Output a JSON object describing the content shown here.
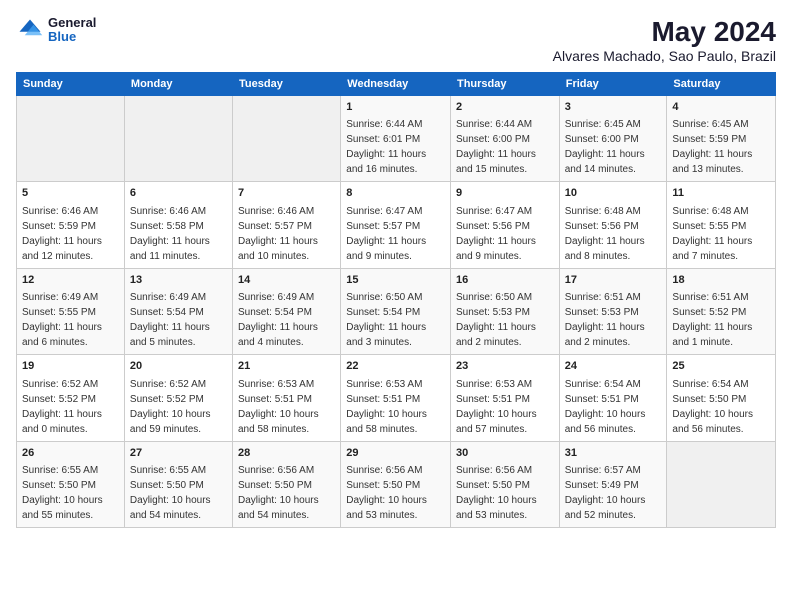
{
  "logo": {
    "line1": "General",
    "line2": "Blue"
  },
  "title": "May 2024",
  "subtitle": "Alvares Machado, Sao Paulo, Brazil",
  "days_of_week": [
    "Sunday",
    "Monday",
    "Tuesday",
    "Wednesday",
    "Thursday",
    "Friday",
    "Saturday"
  ],
  "weeks": [
    [
      {
        "day": "",
        "info": ""
      },
      {
        "day": "",
        "info": ""
      },
      {
        "day": "",
        "info": ""
      },
      {
        "day": "1",
        "info": "Sunrise: 6:44 AM\nSunset: 6:01 PM\nDaylight: 11 hours and 16 minutes."
      },
      {
        "day": "2",
        "info": "Sunrise: 6:44 AM\nSunset: 6:00 PM\nDaylight: 11 hours and 15 minutes."
      },
      {
        "day": "3",
        "info": "Sunrise: 6:45 AM\nSunset: 6:00 PM\nDaylight: 11 hours and 14 minutes."
      },
      {
        "day": "4",
        "info": "Sunrise: 6:45 AM\nSunset: 5:59 PM\nDaylight: 11 hours and 13 minutes."
      }
    ],
    [
      {
        "day": "5",
        "info": "Sunrise: 6:46 AM\nSunset: 5:59 PM\nDaylight: 11 hours and 12 minutes."
      },
      {
        "day": "6",
        "info": "Sunrise: 6:46 AM\nSunset: 5:58 PM\nDaylight: 11 hours and 11 minutes."
      },
      {
        "day": "7",
        "info": "Sunrise: 6:46 AM\nSunset: 5:57 PM\nDaylight: 11 hours and 10 minutes."
      },
      {
        "day": "8",
        "info": "Sunrise: 6:47 AM\nSunset: 5:57 PM\nDaylight: 11 hours and 9 minutes."
      },
      {
        "day": "9",
        "info": "Sunrise: 6:47 AM\nSunset: 5:56 PM\nDaylight: 11 hours and 9 minutes."
      },
      {
        "day": "10",
        "info": "Sunrise: 6:48 AM\nSunset: 5:56 PM\nDaylight: 11 hours and 8 minutes."
      },
      {
        "day": "11",
        "info": "Sunrise: 6:48 AM\nSunset: 5:55 PM\nDaylight: 11 hours and 7 minutes."
      }
    ],
    [
      {
        "day": "12",
        "info": "Sunrise: 6:49 AM\nSunset: 5:55 PM\nDaylight: 11 hours and 6 minutes."
      },
      {
        "day": "13",
        "info": "Sunrise: 6:49 AM\nSunset: 5:54 PM\nDaylight: 11 hours and 5 minutes."
      },
      {
        "day": "14",
        "info": "Sunrise: 6:49 AM\nSunset: 5:54 PM\nDaylight: 11 hours and 4 minutes."
      },
      {
        "day": "15",
        "info": "Sunrise: 6:50 AM\nSunset: 5:54 PM\nDaylight: 11 hours and 3 minutes."
      },
      {
        "day": "16",
        "info": "Sunrise: 6:50 AM\nSunset: 5:53 PM\nDaylight: 11 hours and 2 minutes."
      },
      {
        "day": "17",
        "info": "Sunrise: 6:51 AM\nSunset: 5:53 PM\nDaylight: 11 hours and 2 minutes."
      },
      {
        "day": "18",
        "info": "Sunrise: 6:51 AM\nSunset: 5:52 PM\nDaylight: 11 hours and 1 minute."
      }
    ],
    [
      {
        "day": "19",
        "info": "Sunrise: 6:52 AM\nSunset: 5:52 PM\nDaylight: 11 hours and 0 minutes."
      },
      {
        "day": "20",
        "info": "Sunrise: 6:52 AM\nSunset: 5:52 PM\nDaylight: 10 hours and 59 minutes."
      },
      {
        "day": "21",
        "info": "Sunrise: 6:53 AM\nSunset: 5:51 PM\nDaylight: 10 hours and 58 minutes."
      },
      {
        "day": "22",
        "info": "Sunrise: 6:53 AM\nSunset: 5:51 PM\nDaylight: 10 hours and 58 minutes."
      },
      {
        "day": "23",
        "info": "Sunrise: 6:53 AM\nSunset: 5:51 PM\nDaylight: 10 hours and 57 minutes."
      },
      {
        "day": "24",
        "info": "Sunrise: 6:54 AM\nSunset: 5:51 PM\nDaylight: 10 hours and 56 minutes."
      },
      {
        "day": "25",
        "info": "Sunrise: 6:54 AM\nSunset: 5:50 PM\nDaylight: 10 hours and 56 minutes."
      }
    ],
    [
      {
        "day": "26",
        "info": "Sunrise: 6:55 AM\nSunset: 5:50 PM\nDaylight: 10 hours and 55 minutes."
      },
      {
        "day": "27",
        "info": "Sunrise: 6:55 AM\nSunset: 5:50 PM\nDaylight: 10 hours and 54 minutes."
      },
      {
        "day": "28",
        "info": "Sunrise: 6:56 AM\nSunset: 5:50 PM\nDaylight: 10 hours and 54 minutes."
      },
      {
        "day": "29",
        "info": "Sunrise: 6:56 AM\nSunset: 5:50 PM\nDaylight: 10 hours and 53 minutes."
      },
      {
        "day": "30",
        "info": "Sunrise: 6:56 AM\nSunset: 5:50 PM\nDaylight: 10 hours and 53 minutes."
      },
      {
        "day": "31",
        "info": "Sunrise: 6:57 AM\nSunset: 5:49 PM\nDaylight: 10 hours and 52 minutes."
      },
      {
        "day": "",
        "info": ""
      }
    ]
  ]
}
